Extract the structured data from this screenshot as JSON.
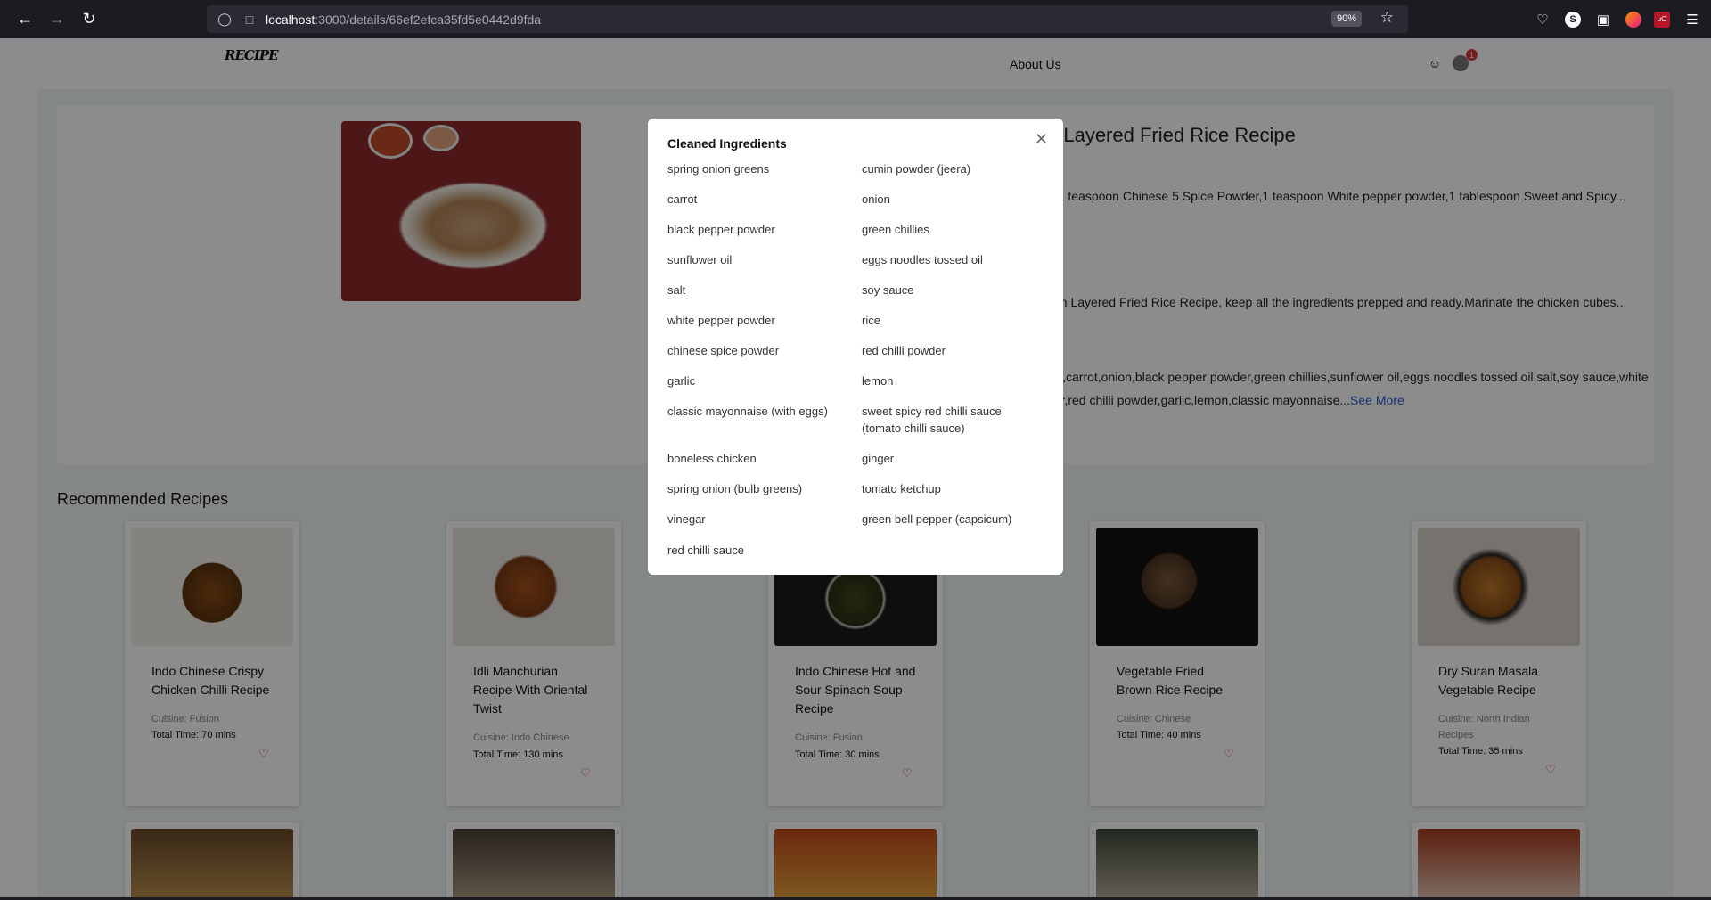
{
  "browser": {
    "url_host": "localhost",
    "url_path": ":3000/details/66ef2efca35fd5e0442d9fda",
    "zoom": "90%",
    "ext_s": "S",
    "ext_ub": "uO"
  },
  "header": {
    "logo": "RECIPE",
    "about_label": "About Us",
    "cart_count": "1"
  },
  "detail": {
    "title_visible": "n Layered Fried Rice Recipe",
    "ingredients_text": "d,1 teaspoon Chinese 5 Spice Powder,1 teaspoon White pepper powder,1 tablespoon Sweet and Spicy...",
    "instructions_text": "ken Layered Fried Rice Recipe, keep all the ingredients prepped and ready.Marinate the chicken cubes...",
    "cleaned_line1": "ra),carrot,onion,black pepper powder,green chillies,sunflower oil,eggs noodles tossed oil,salt,soy sauce,white",
    "cleaned_line2": "der,red chilli powder,garlic,lemon,classic mayonnaise...",
    "see_more": "See More"
  },
  "recommended": {
    "title": "Recommended Recipes",
    "cards": [
      {
        "name": "Indo Chinese Crispy Chicken Chilli Recipe",
        "cuisine": "Cuisine: Fusion",
        "time": "Total Time: 70 mins"
      },
      {
        "name": "Idli Manchurian Recipe With Oriental Twist",
        "cuisine": "Cuisine: Indo Chinese",
        "time": "Total Time: 130 mins"
      },
      {
        "name": "Indo Chinese Hot and Sour Spinach Soup Recipe",
        "cuisine": "Cuisine: Fusion",
        "time": "Total Time: 30 mins"
      },
      {
        "name": "Vegetable Fried Brown Rice Recipe",
        "cuisine": "Cuisine: Chinese",
        "time": "Total Time: 40 mins"
      },
      {
        "name": "Dry Suran Masala Vegetable Recipe",
        "cuisine": "Cuisine: North Indian Recipes",
        "time": "Total Time: 35 mins"
      }
    ]
  },
  "modal": {
    "title": "Cleaned Ingredients",
    "left": [
      "spring onion greens",
      "carrot",
      "black pepper powder",
      "sunflower oil",
      "salt",
      "white pepper powder",
      "chinese spice powder",
      "garlic",
      "classic mayonnaise (with eggs)",
      "boneless chicken",
      "spring onion (bulb greens)",
      "vinegar",
      "red chilli sauce"
    ],
    "right": [
      "cumin powder (jeera)",
      "onion",
      "green chillies",
      "eggs noodles tossed oil",
      "soy sauce",
      "rice",
      "red chilli powder",
      "lemon",
      "sweet spicy red chilli sauce (tomato chilli sauce)",
      "ginger",
      "tomato ketchup",
      "green bell pepper (capsicum)"
    ]
  }
}
